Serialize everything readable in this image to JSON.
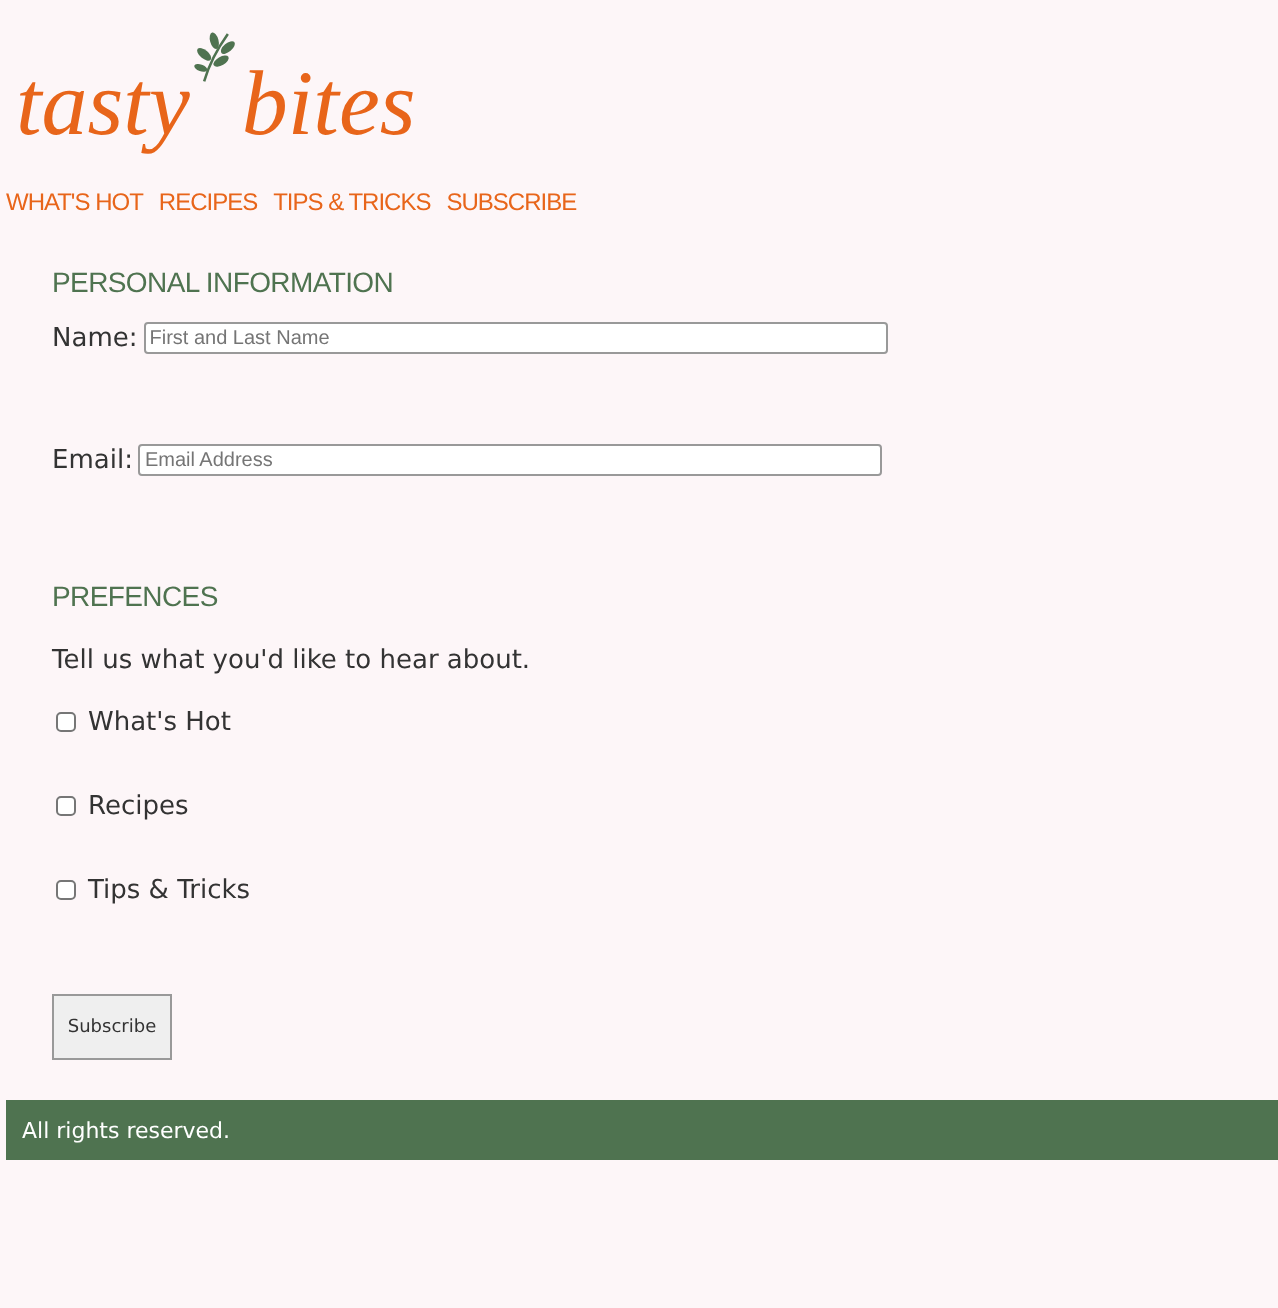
{
  "logo": {
    "words": [
      "tasty",
      "bites"
    ]
  },
  "nav": [
    "WHAT'S HOT",
    "RECIPES",
    "TIPS & TRICKS",
    "SUBSCRIBE"
  ],
  "personal": {
    "heading": "PERSONAL INFORMATION",
    "fields": [
      {
        "label": "Name:",
        "placeholder": "First and Last Name"
      },
      {
        "label": "Email:",
        "placeholder": "Email Address"
      }
    ]
  },
  "preferences": {
    "heading": "PREFENCES",
    "intro": "Tell us what you'd like to hear about.",
    "options": [
      {
        "label": "What's Hot",
        "checked": false
      },
      {
        "label": "Recipes",
        "checked": false
      },
      {
        "label": "Tips & Tricks",
        "checked": false
      }
    ]
  },
  "submit": "Subscribe",
  "footer": "All rights reserved."
}
